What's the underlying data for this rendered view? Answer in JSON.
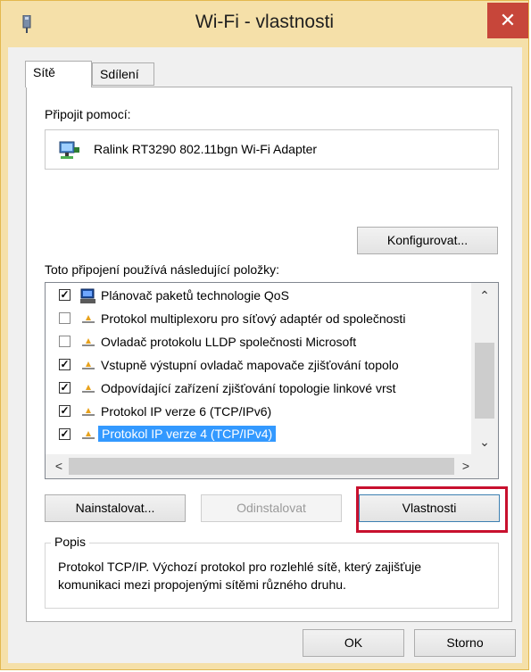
{
  "window": {
    "title": "Wi-Fi - vlastnosti",
    "close_symbol": "✕",
    "icon": "network-adapter-icon"
  },
  "tabs": [
    {
      "label": "Sítě",
      "active": true
    },
    {
      "label": "Sdílení",
      "active": false
    }
  ],
  "connect_using": {
    "label": "Připojit pomocí:",
    "adapter_name": "Ralink RT3290 802.11bgn Wi-Fi Adapter",
    "configure_label": "Konfigurovat..."
  },
  "items_section": {
    "label": "Toto připojení používá následující položky:",
    "items": [
      {
        "checked": true,
        "icon": "qos-scheduler-icon",
        "label": "Plánovač paketů technologie QoS",
        "selected": false
      },
      {
        "checked": false,
        "icon": "protocol-icon",
        "label": "Protokol multiplexoru pro síťový adaptér od společnosti",
        "selected": false
      },
      {
        "checked": false,
        "icon": "protocol-icon",
        "label": "Ovladač protokolu LLDP společnosti Microsoft",
        "selected": false
      },
      {
        "checked": true,
        "icon": "protocol-icon",
        "label": "Vstupně výstupní ovladač mapovače zjišťování topolo",
        "selected": false
      },
      {
        "checked": true,
        "icon": "protocol-icon",
        "label": "Odpovídající zařízení zjišťování topologie linkové vrst",
        "selected": false
      },
      {
        "checked": true,
        "icon": "protocol-icon",
        "label": "Protokol IP verze 6 (TCP/IPv6)",
        "selected": false
      },
      {
        "checked": true,
        "icon": "protocol-icon",
        "label": "Protokol IP verze 4 (TCP/IPv4)",
        "selected": true
      }
    ]
  },
  "buttons": {
    "install": "Nainstalovat...",
    "uninstall": "Odinstalovat",
    "properties": "Vlastnosti",
    "ok": "OK",
    "cancel": "Storno"
  },
  "description": {
    "title": "Popis",
    "text": "Protokol TCP/IP. Výchozí protokol pro rozlehlé sítě, který zajišťuje komunikaci mezi propojenými sítěmi různého druhu."
  },
  "colors": {
    "frame": "#f5e0a9",
    "close": "#c7463a",
    "selection": "#3399ff",
    "highlight": "#c8102e"
  }
}
